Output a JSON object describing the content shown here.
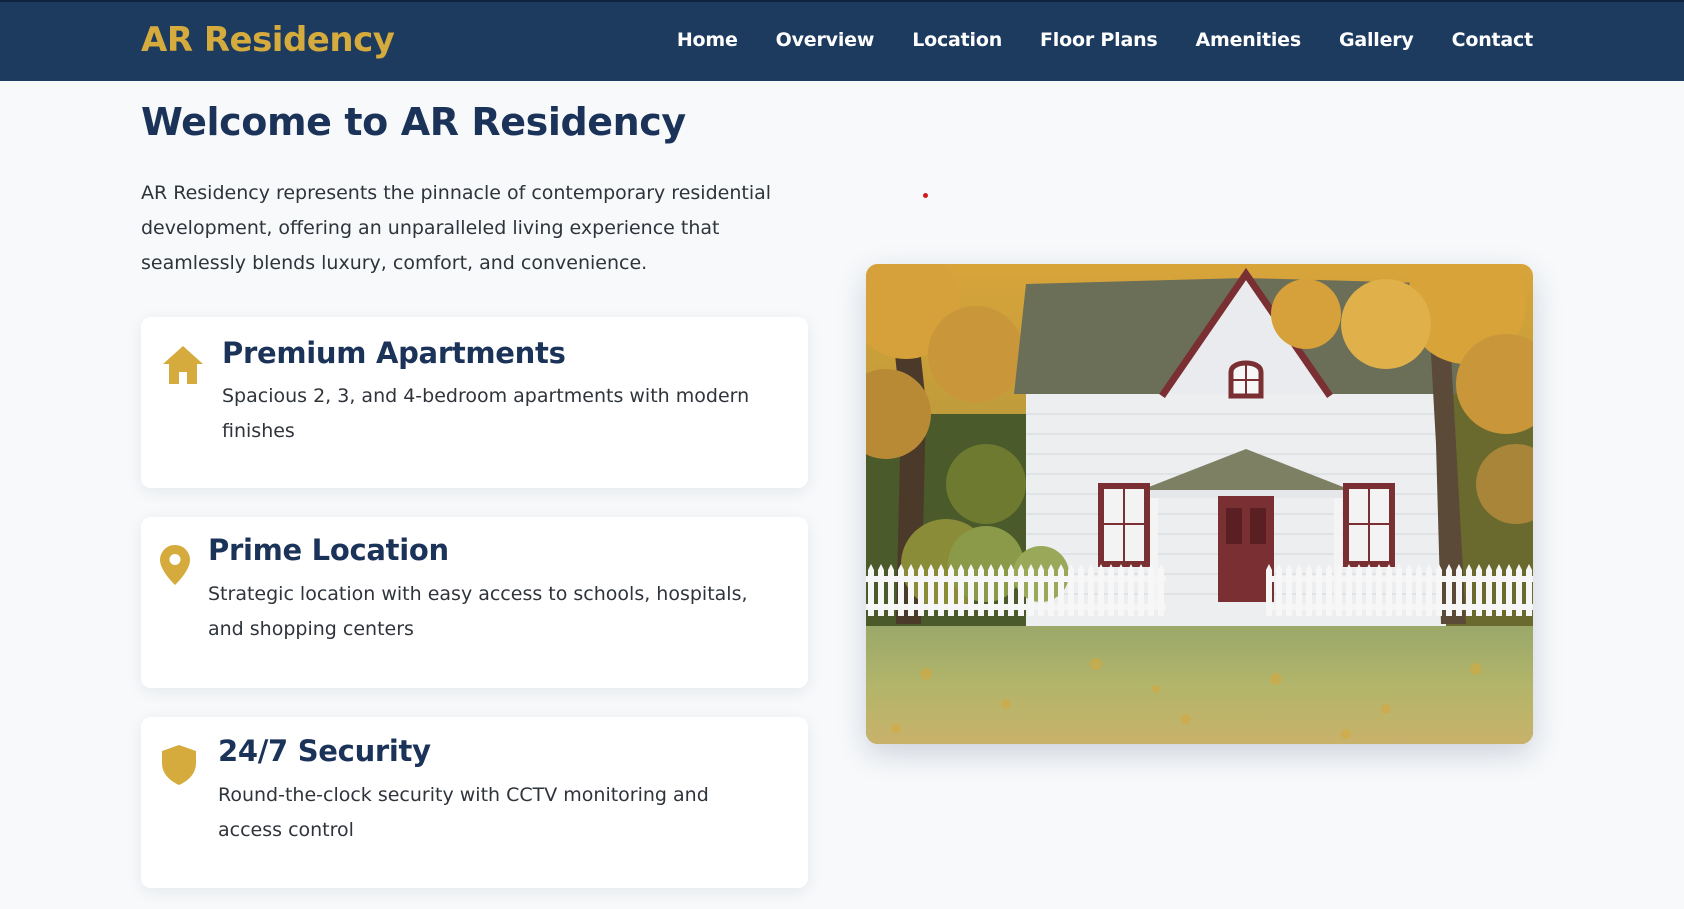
{
  "nav": {
    "brand": "AR Residency",
    "links": [
      "Home",
      "Overview",
      "Location",
      "Floor Plans",
      "Amenities",
      "Gallery",
      "Contact"
    ]
  },
  "hero": {
    "title": "Welcome to AR Residency",
    "intro": "AR Residency represents the pinnacle of contemporary residential development, offering an unparalleled living experience that seamlessly blends luxury, comfort, and convenience."
  },
  "features": [
    {
      "icon": "home-icon",
      "title": "Premium Apartments",
      "description": "Spacious 2, 3, and 4-bedroom apartments with modern finishes"
    },
    {
      "icon": "location-pin-icon",
      "title": "Prime Location",
      "description": "Strategic location with easy access to schools, hospitals, and shopping centers"
    },
    {
      "icon": "shield-icon",
      "title": "24/7 Security",
      "description": "Round-the-clock security with CCTV monitoring and access control"
    }
  ],
  "colors": {
    "navbar": "#1d3a5f",
    "accent_gold": "#d4ab3c",
    "heading_navy": "#1b3358",
    "background": "#f7f9fb"
  }
}
